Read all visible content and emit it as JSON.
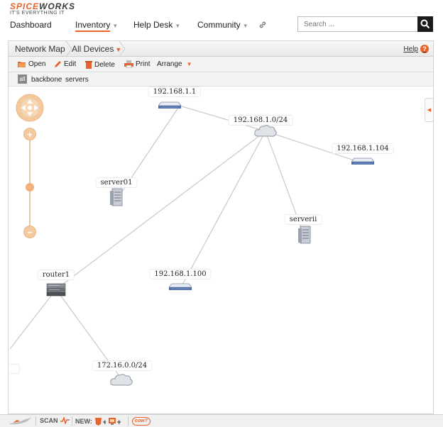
{
  "brand": {
    "logo_part1": "SPICE",
    "logo_part2": "WORKS",
    "tagline": "IT'S EVERYTHING IT"
  },
  "nav": {
    "items": [
      {
        "label": "Dashboard",
        "has_menu": false
      },
      {
        "label": "Inventory",
        "has_menu": true,
        "active": true
      },
      {
        "label": "Help Desk",
        "has_menu": true
      },
      {
        "label": "Community",
        "has_menu": true
      }
    ],
    "caret": "▼",
    "link_icon": "link-icon"
  },
  "search": {
    "placeholder": "Search ...",
    "icon": "search-icon"
  },
  "breadcrumb": {
    "items": [
      "Network Map",
      "All Devices"
    ],
    "dropdown_caret": "▼"
  },
  "help": {
    "label": "Help",
    "icon_text": "?"
  },
  "toolbar": {
    "open": "Open",
    "edit": "Edit",
    "delete": "Delete",
    "print": "Print",
    "arrange": "Arrange",
    "arrange_caret": "▼"
  },
  "groups": {
    "all_label": "all",
    "items": [
      "backbone",
      "servers"
    ]
  },
  "map": {
    "nodes": [
      {
        "id": "gw",
        "label": "192.168.1.1",
        "icon": "switch-icon"
      },
      {
        "id": "subnet",
        "label": "192.168.1.0/24",
        "icon": "cloud-icon"
      },
      {
        "id": "host104",
        "label": "192.168.1.104",
        "icon": "switch-icon"
      },
      {
        "id": "server01",
        "label": "server01",
        "icon": "server-icon"
      },
      {
        "id": "serverii",
        "label": "serverii",
        "icon": "server-icon"
      },
      {
        "id": "host100",
        "label": "192.168.1.100",
        "icon": "switch-icon"
      },
      {
        "id": "router1",
        "label": "router1",
        "icon": "router-icon"
      },
      {
        "id": "subnet2",
        "label": "172.16.0.0/24",
        "icon": "cloud-icon"
      }
    ],
    "edges": [
      [
        "gw",
        "subnet"
      ],
      [
        "gw",
        "server01"
      ],
      [
        "subnet",
        "host104"
      ],
      [
        "subnet",
        "serverii"
      ],
      [
        "subnet",
        "host100"
      ],
      [
        "subnet",
        "router1"
      ],
      [
        "router1",
        "subnet2"
      ],
      [
        "router1",
        "offscreen"
      ]
    ],
    "side_tab_arrow": "◀"
  },
  "zoom": {
    "in": "+",
    "out": "−",
    "level": 0.42
  },
  "bottombar": {
    "scan": "SCAN",
    "new": "NEW:",
    "cow": "cow?"
  },
  "colors": {
    "accent": "#e8642c",
    "edge": "#c8c8c8",
    "cloud": "#c8ccd2"
  }
}
